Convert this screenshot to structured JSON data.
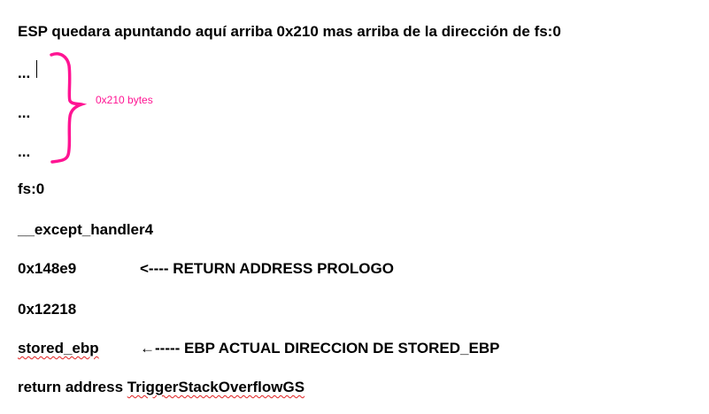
{
  "document": {
    "heading": "ESP quedara apuntando aquí arriba 0x210 mas arriba de la dirección de fs:0",
    "lines": [
      "...",
      "...",
      "...",
      "fs:0",
      "__except_handler4",
      "0x148e9",
      "0x12218",
      "stored_ebp"
    ],
    "annotation_brace_label": "0x210 bytes",
    "annotation_color": "#ff1493",
    "arrow_return": "<---- RETURN ADDRESS PROLOGO",
    "arrow_ebp": "←----- EBP ACTUAL DIRECCION DE STORED_EBP",
    "last_line_prefix": "return address ",
    "last_line_func": "TriggerStackOverflowGS"
  }
}
